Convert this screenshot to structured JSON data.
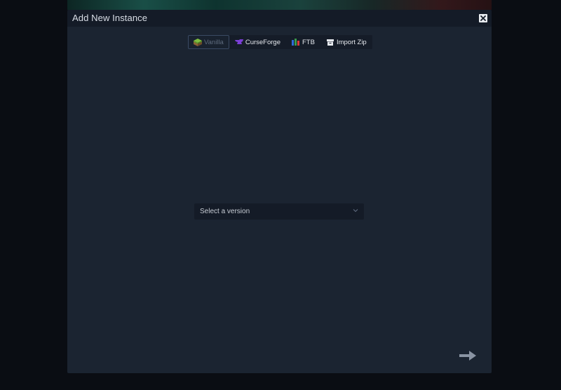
{
  "modal": {
    "title": "Add New Instance",
    "close_icon": "close-icon"
  },
  "tabs": [
    {
      "label": "Vanilla",
      "icon": "grass-block-icon",
      "active": true
    },
    {
      "label": "CurseForge",
      "icon": "curseforge-icon",
      "active": false
    },
    {
      "label": "FTB",
      "icon": "ftb-icon",
      "active": false
    },
    {
      "label": "Import Zip",
      "icon": "archive-icon",
      "active": false
    }
  ],
  "version_select": {
    "placeholder": "Select a version",
    "icon": "chevron-down-icon"
  },
  "next": {
    "icon": "arrow-right-icon"
  },
  "colors": {
    "modal_bg": "#1b2431",
    "header_bg": "#141b27",
    "page_bg": "#0a0d13",
    "curseforge_purple": "#7b3fd6",
    "ftb_blue": "#2f6bd8",
    "ftb_red": "#d83a3a"
  }
}
